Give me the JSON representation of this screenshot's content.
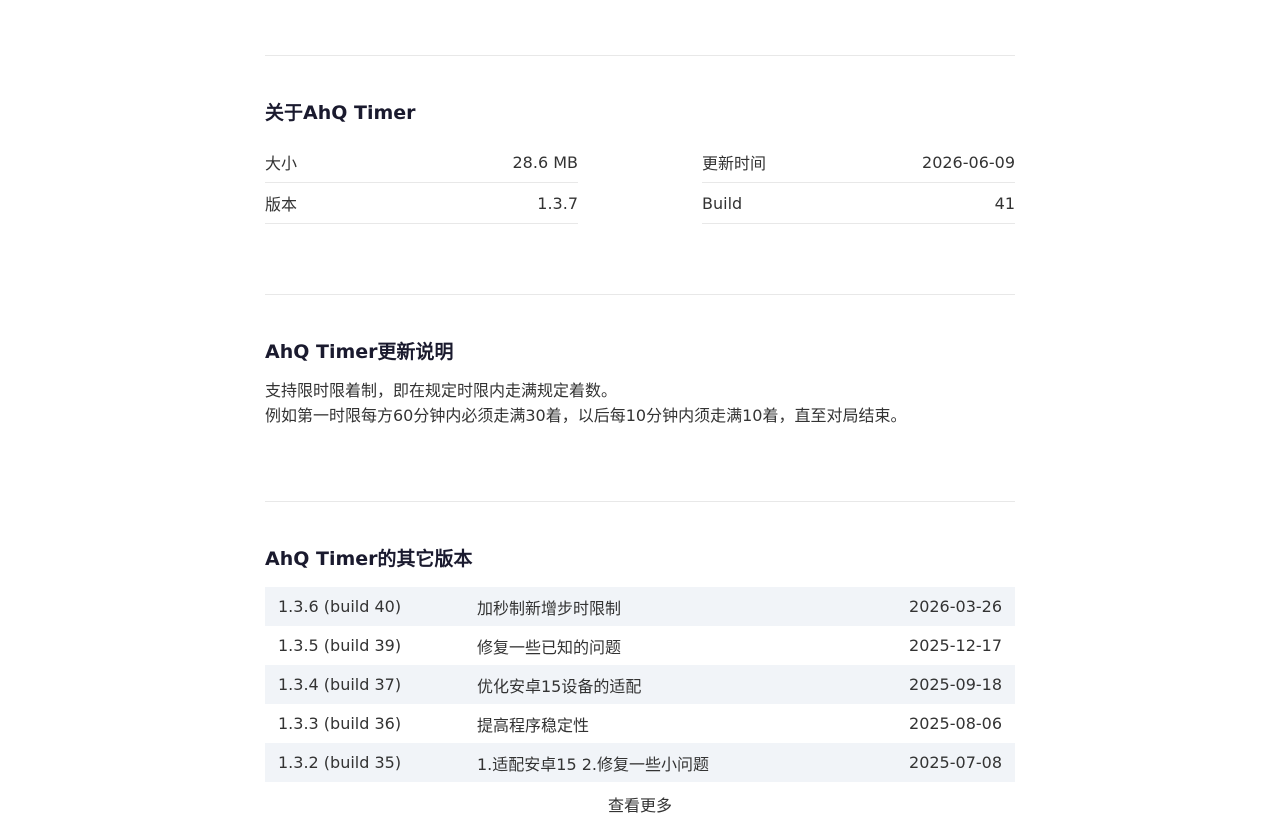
{
  "about": {
    "title": "关于AhQ Timer",
    "left": [
      {
        "key": "大小",
        "value": "28.6 MB"
      },
      {
        "key": "版本",
        "value": "1.3.7"
      }
    ],
    "right": [
      {
        "key": "更新时间",
        "value": "2026-06-09"
      },
      {
        "key": "Build",
        "value": "41"
      }
    ]
  },
  "update_notes": {
    "title": "AhQ Timer更新说明",
    "lines": [
      "支持限时限着制，即在规定时限内走满规定着数。",
      "例如第一时限每方60分钟内必须走满30着，以后每10分钟内须走满10着，直至对局结束。"
    ]
  },
  "other_versions": {
    "title": "AhQ Timer的其它版本",
    "rows": [
      {
        "version": "1.3.6 (build 40)",
        "desc": "加秒制新增步时限制",
        "date": "2026-03-26"
      },
      {
        "version": "1.3.5 (build 39)",
        "desc": "修复一些已知的问题",
        "date": "2025-12-17"
      },
      {
        "version": "1.3.4 (build 37)",
        "desc": "优化安卓15设备的适配",
        "date": "2025-09-18"
      },
      {
        "version": "1.3.3 (build 36)",
        "desc": "提高程序稳定性",
        "date": "2025-08-06"
      },
      {
        "version": "1.3.2 (build 35)",
        "desc": "1.适配安卓15 2.修复一些小问题",
        "date": "2025-07-08"
      }
    ],
    "more_label": "查看更多"
  }
}
